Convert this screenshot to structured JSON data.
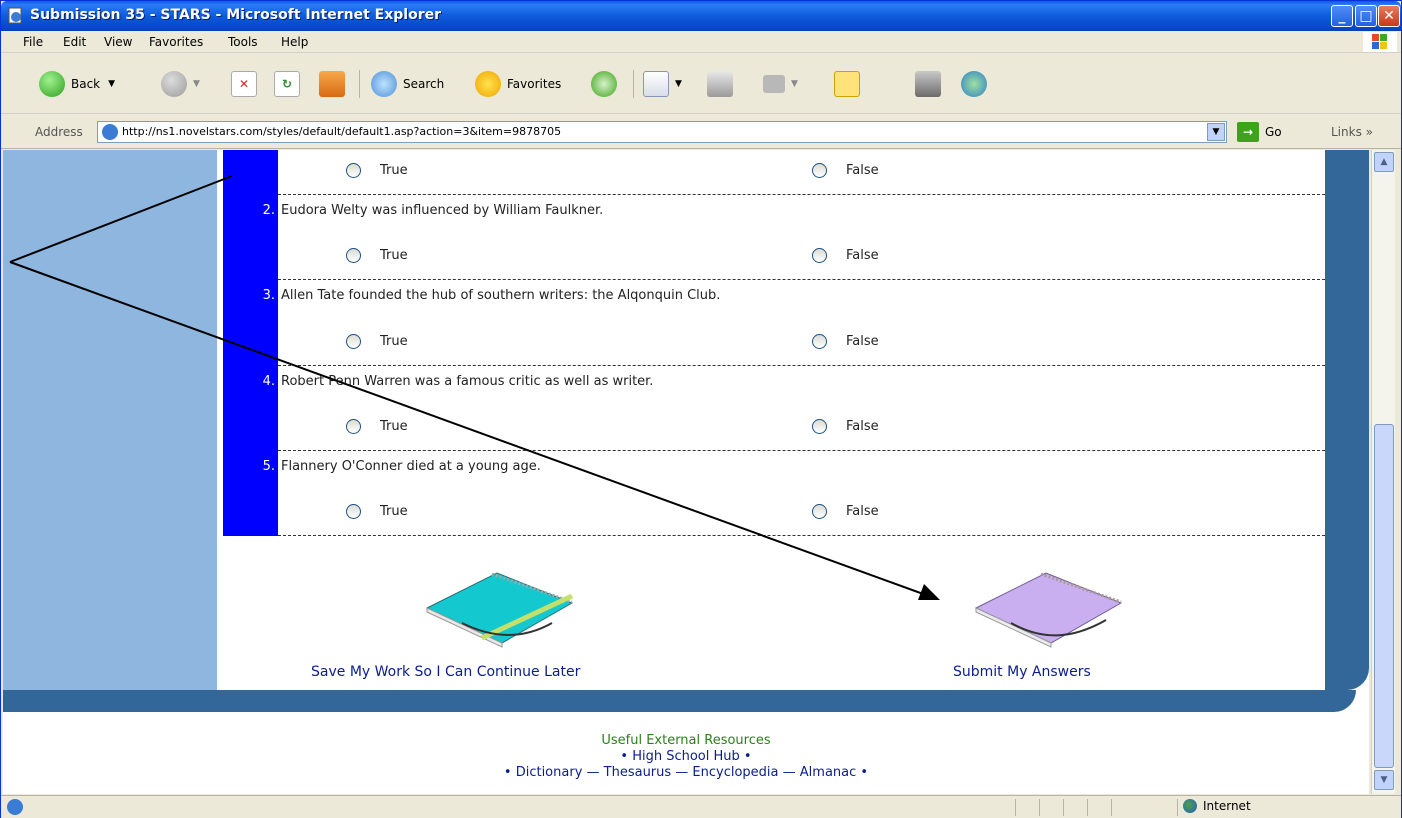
{
  "window": {
    "title": "Submission 35 - STARS - Microsoft Internet Explorer"
  },
  "menu": [
    "File",
    "Edit",
    "View",
    "Favorites",
    "Tools",
    "Help"
  ],
  "toolbar": {
    "back_label": "Back",
    "search_label": "Search",
    "favorites_label": "Favorites"
  },
  "address": {
    "label": "Address",
    "url": "http://ns1.novelstars.com/styles/default/default1.asp?action=3&item=9878705",
    "go_label": "Go",
    "links_label": "Links"
  },
  "quiz": {
    "option_true": "True",
    "option_false": "False",
    "questions": [
      {
        "number": "",
        "text": ""
      },
      {
        "number": "2.",
        "text": "Eudora Welty was influenced by William Faulkner."
      },
      {
        "number": "3.",
        "text": "Allen Tate founded the hub of southern writers: the Alqonquin Club."
      },
      {
        "number": "4.",
        "text": "Robert Penn Warren was a famous critic as well as writer."
      },
      {
        "number": "5.",
        "text": "Flannery O'Conner died at a young age."
      }
    ]
  },
  "actions": {
    "save_label": "Save My Work So I Can Continue Later",
    "submit_label": "Submit My Answers"
  },
  "footer": {
    "title": "Useful External Resources",
    "line1": "• High School Hub •",
    "line2": "• Dictionary — Thesaurus — Encyclopedia — Almanac •"
  },
  "status": {
    "zone": "Internet"
  },
  "colors": {
    "title_bar": "#0a5ae6",
    "question_number_column": "#0000ff",
    "left_panel": "#8eb6de",
    "frame_dark": "#336699",
    "footer_title": "#2e7d1e",
    "link": "#0a1e8c"
  }
}
